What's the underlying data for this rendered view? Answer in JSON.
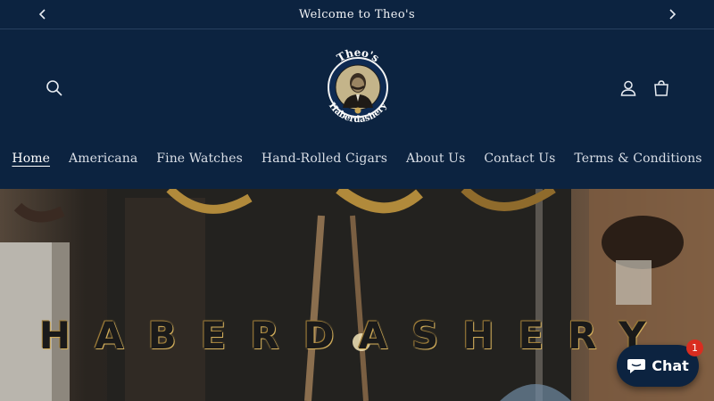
{
  "announcement": {
    "text": "Welcome to Theo's",
    "prev_icon": "chevron-left-icon",
    "next_icon": "chevron-right-icon"
  },
  "header": {
    "logo_top_text": "Theo's",
    "logo_bottom_text": "Haberdashery",
    "icons": [
      "search-icon",
      "account-icon",
      "cart-icon"
    ]
  },
  "nav": {
    "items": [
      {
        "label": "Home",
        "active": true
      },
      {
        "label": "Americana"
      },
      {
        "label": "Fine Watches"
      },
      {
        "label": "Hand-Rolled Cigars"
      },
      {
        "label": "About Us"
      },
      {
        "label": "Contact Us"
      },
      {
        "label": "Terms & Conditions"
      }
    ]
  },
  "hero": {
    "sign_text": "HABERDASHERY"
  },
  "chat": {
    "label": "Chat",
    "badge": "1",
    "icon": "chat-bubble-icon"
  },
  "colors": {
    "background": "#0c2340",
    "badge": "#d92d20",
    "gold": "#c9a553"
  }
}
